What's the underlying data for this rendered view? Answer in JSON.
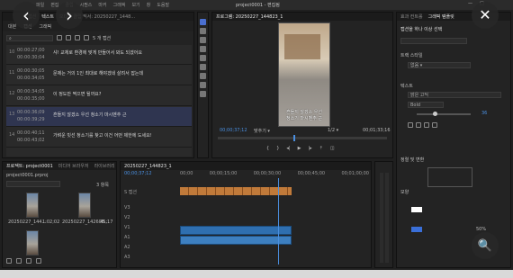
{
  "window": {
    "title": "project0001 - 편집됨",
    "menu": [
      "파일",
      "편집",
      "클립",
      "시퀀스",
      "마커",
      "그래픽",
      "보기",
      "창",
      "도움말"
    ]
  },
  "left_panel": {
    "tabs": [
      "캡션",
      "텍스트",
      "오디오 클립 믹서: 20250227_1448..."
    ],
    "sub_tabs": [
      "대본",
      "캡션",
      "그래픽"
    ],
    "count": "5 개 캡션",
    "captions": [
      {
        "num": "10",
        "in": "00:00:27;00",
        "out": "00:00:30;04",
        "text": "샤! 교체로 환경에 맞게 만들어서 봐도 되겠어요"
      },
      {
        "num": "11",
        "in": "00:00:30;05",
        "out": "00:00:34;05",
        "text": "문제는 거의 1인 최대로 해야겠네 살려서 잡는데"
      },
      {
        "num": "12",
        "in": "00:00:34;05",
        "out": "00:00:35;00",
        "text": "이 정도만 찍으면 될까요?"
      },
      {
        "num": "13",
        "in": "00:00:36;09",
        "out": "00:00:39;29",
        "text": "흔들지 않겠소 우선 청소기 마시벤추 근 "
      },
      {
        "num": "14",
        "in": "00:00:40;11",
        "out": "00:00:43;02",
        "text": "가벼운 빗선 청소기를 찾고 이건 어떤 제한에 도세요!"
      }
    ]
  },
  "project_panel": {
    "tabs": [
      "프로젝트: project0001",
      "미디어 브라우저",
      "라이브러리"
    ],
    "file": "project0001.prproj",
    "count": "3 항목",
    "items": [
      {
        "name": "20250227_144...",
        "duration": "1:02;02"
      },
      {
        "name": "20250227_14260B...",
        "duration": "45;17"
      },
      {
        "name": "",
        "duration": ""
      }
    ]
  },
  "program_monitor": {
    "tab": "프로그램: 20250227_144823_1",
    "subtitle_line1": "흔들지 않겠소 우선",
    "subtitle_line2": "청소기 마시벤추 근",
    "timecode": "00;00;37;12",
    "fit": "맞추기",
    "quality": "1/2",
    "duration": "00;01;33;16"
  },
  "timeline": {
    "tab": "20250227_144823_1",
    "timecode": "00;00;37;12",
    "ruler": [
      "00;00",
      "00;00;15;00",
      "00;00;30;00",
      "00;00;45;00",
      "00;01;00;00"
    ],
    "subtitle_track": "S 캡션",
    "tracks": [
      "V3",
      "V2",
      "V1",
      "A1",
      "A2",
      "A3"
    ]
  },
  "essential_graphics": {
    "tabs": [
      "효과 컨트롤",
      "그래픽 템플릿"
    ],
    "header": "캡션을 하나 이상 선택",
    "track_style": "트랙 스타일",
    "style_value": "없음",
    "text_section": "텍스트",
    "font": "맑은 고딕",
    "weight": "Bold",
    "size": "36",
    "alignment": "정렬 및 변환",
    "appearance": "모양",
    "opacity": "50%",
    "colors": {
      "fill": "#ffffff",
      "accent": "#3a6fd8"
    }
  },
  "overlay": {
    "back": "‹",
    "forward": "›",
    "close": "✕",
    "lens": "🔍"
  }
}
